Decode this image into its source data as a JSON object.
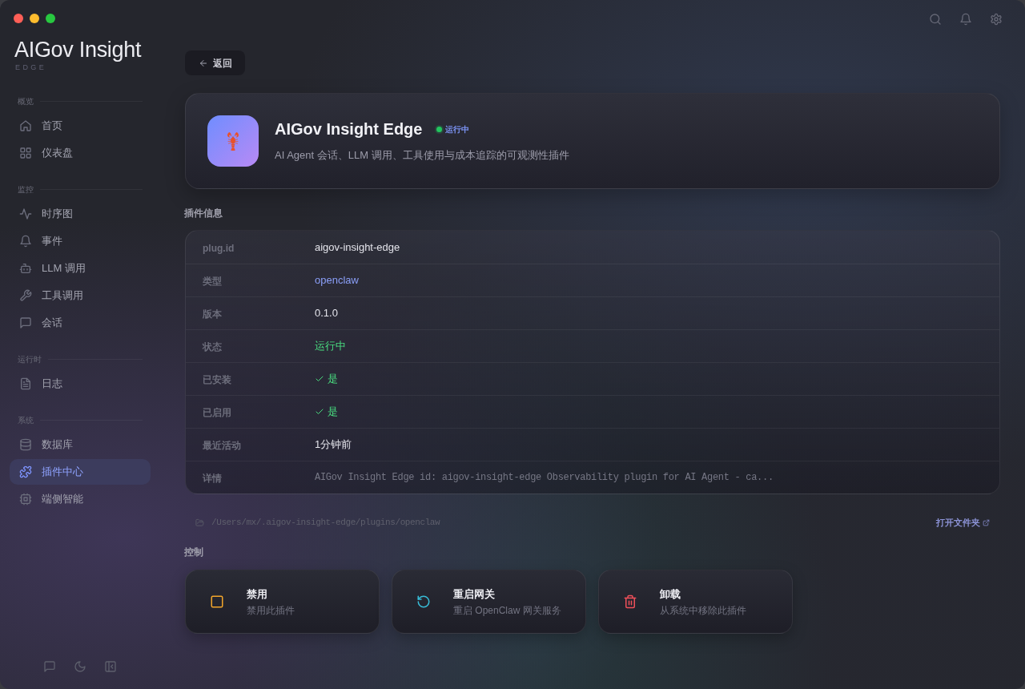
{
  "sidebar": {
    "brand": {
      "title": "AIGov Insight",
      "subtitle": "EDGE"
    },
    "sections": [
      {
        "label": "概览",
        "items": [
          {
            "label": "首页",
            "selected": false
          },
          {
            "label": "仪表盘",
            "selected": false
          }
        ]
      },
      {
        "label": "监控",
        "items": [
          {
            "label": "时序图",
            "selected": false
          },
          {
            "label": "事件",
            "selected": false
          },
          {
            "label": "LLM 调用",
            "selected": false
          },
          {
            "label": "工具调用",
            "selected": false
          },
          {
            "label": "会话",
            "selected": false
          }
        ]
      },
      {
        "label": "运行时",
        "items": [
          {
            "label": "日志",
            "selected": false
          }
        ]
      },
      {
        "label": "系统",
        "items": [
          {
            "label": "数据库",
            "selected": false
          },
          {
            "label": "插件中心",
            "selected": true
          },
          {
            "label": "端侧智能",
            "selected": false
          }
        ]
      }
    ]
  },
  "back_button": {
    "label": "返回"
  },
  "plugin": {
    "name": "AIGov Insight Edge",
    "status_badge": {
      "kind": "running",
      "label": "运行中"
    },
    "description": "AI Agent 会话、LLM 调用、工具使用与成本追踪的可观测性插件"
  },
  "info": {
    "title": "插件信息",
    "rows": [
      {
        "label": "plug.id",
        "value": "aigov-insight-edge",
        "kind": "text"
      },
      {
        "label": "类型",
        "value": "openclaw",
        "kind": "link"
      },
      {
        "label": "版本",
        "value": "0.1.0",
        "kind": "text"
      },
      {
        "label": "状态",
        "value": "运行中",
        "kind": "status"
      },
      {
        "label": "已安装",
        "value": "是",
        "kind": "check"
      },
      {
        "label": "已启用",
        "value": "是",
        "kind": "check"
      },
      {
        "label": "最近活动",
        "value": "1分钟前",
        "kind": "text"
      },
      {
        "label": "详情",
        "value": "AIGov Insight Edge id: aigov-insight-edge Observability plugin for AI Agent - ca...",
        "kind": "code"
      }
    ]
  },
  "path": {
    "text": "/Users/mx/.aigov-insight-edge/plugins/openclaw",
    "link": "打开文件夹"
  },
  "controls": {
    "title": "控制",
    "actions": [
      {
        "kind": "disable",
        "title": "禁用",
        "description": "禁用此插件"
      },
      {
        "kind": "restart",
        "title": "重启网关",
        "description": "重启 OpenClaw 网关服务"
      },
      {
        "kind": "uninstall",
        "title": "卸载",
        "description": "从系统中移除此插件"
      }
    ]
  }
}
